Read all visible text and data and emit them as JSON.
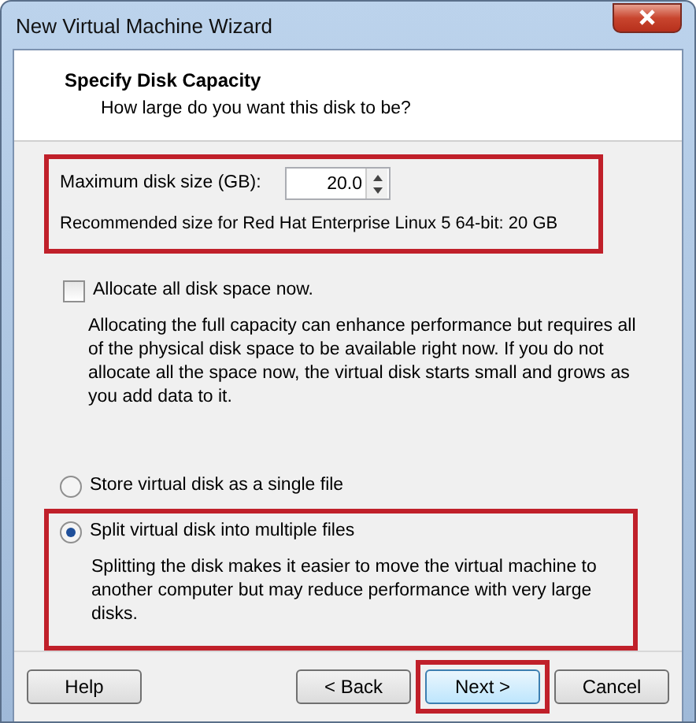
{
  "window": {
    "title": "New Virtual Machine Wizard"
  },
  "header": {
    "title": "Specify Disk Capacity",
    "subtitle": "How large do you want this disk to be?"
  },
  "disk_size": {
    "label": "Maximum disk size (GB):",
    "value": "20.0",
    "recommendation": "Recommended size for Red Hat Enterprise Linux 5 64-bit: 20 GB",
    "highlighted": true
  },
  "allocate": {
    "label": "Allocate all disk space now.",
    "checked": false,
    "description": "Allocating the full capacity can enhance performance but requires all of the physical disk space to be available right now. If you do not allocate all the space now, the virtual disk starts small and grows as you add data to it."
  },
  "storage_options": [
    {
      "label": "Store virtual disk as a single file",
      "selected": false
    },
    {
      "label": "Split virtual disk into multiple files",
      "selected": true,
      "highlighted": true,
      "description": "Splitting the disk makes it easier to move the virtual machine to another computer but may reduce performance with very large disks."
    }
  ],
  "buttons": [
    {
      "label": "Help",
      "kind": "help",
      "default": false
    },
    {
      "label": "< Back",
      "kind": "nav",
      "default": false
    },
    {
      "label": "Next >",
      "kind": "nav",
      "default": true,
      "highlighted": true
    },
    {
      "label": "Cancel",
      "kind": "nav",
      "default": false
    }
  ]
}
